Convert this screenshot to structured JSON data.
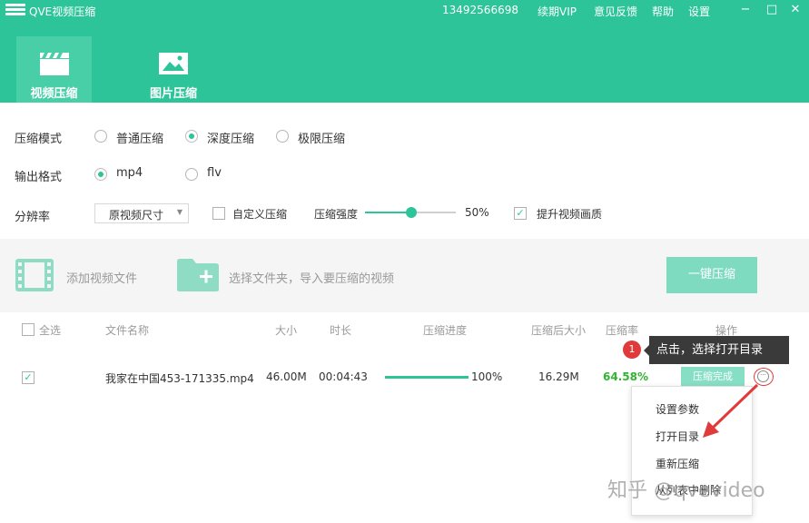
{
  "window": {
    "title": "QVE视频压缩",
    "phone": "13492566698",
    "nav": [
      "续期VIP",
      "意见反馈",
      "帮助",
      "设置"
    ],
    "controls": {
      "minimize": "−",
      "maximize": "□",
      "close": "✕"
    }
  },
  "tabs": [
    {
      "label": "视频压缩",
      "icon": "clapperboard-icon",
      "active": true
    },
    {
      "label": "图片压缩",
      "icon": "image-icon",
      "active": false
    }
  ],
  "options": {
    "mode": {
      "label": "压缩模式",
      "choices": [
        "普通压缩",
        "深度压缩",
        "极限压缩"
      ],
      "selected": "深度压缩"
    },
    "format": {
      "label": "输出格式",
      "choices": [
        "mp4",
        "flv"
      ],
      "selected": "mp4"
    },
    "resolution": {
      "label": "分辨率",
      "select_value": "原视频尺寸",
      "custom_label": "自定义压缩",
      "custom_checked": false,
      "strength_label": "压缩强度",
      "strength_value": "50%",
      "strength_fraction": 0.5,
      "enhance_label": "提升视频画质",
      "enhance_checked": true
    }
  },
  "actions": {
    "add_file": "添加视频文件",
    "add_folder": "选择文件夹，导入要压缩的视频",
    "compress_all": "一键压缩"
  },
  "table": {
    "headers": {
      "select_all": "全选",
      "name": "文件名称",
      "size": "大小",
      "duration": "时长",
      "progress": "压缩进度",
      "size_after": "压缩后大小",
      "ratio": "压缩率",
      "ops": "操作"
    },
    "rows": [
      {
        "checked": true,
        "name": "我家在中国453-171335.mp4",
        "size": "46.00M",
        "duration": "00:04:43",
        "progress_value": 1.0,
        "progress_text": "100%",
        "size_after": "16.29M",
        "ratio": "64.58%",
        "status": "压缩完成"
      }
    ]
  },
  "tooltip": {
    "badge": "1",
    "text": "点击，选择打开目录"
  },
  "context_menu": [
    "设置参数",
    "打开目录",
    "重新压缩",
    "从列表中删除"
  ],
  "watermark": "知乎 @qvevideo",
  "colors": {
    "brand": "#2ec49a",
    "ratio": "#2fb52f",
    "tooltip_bg": "#3a3a3a",
    "annotation_red": "#e03b3b"
  }
}
